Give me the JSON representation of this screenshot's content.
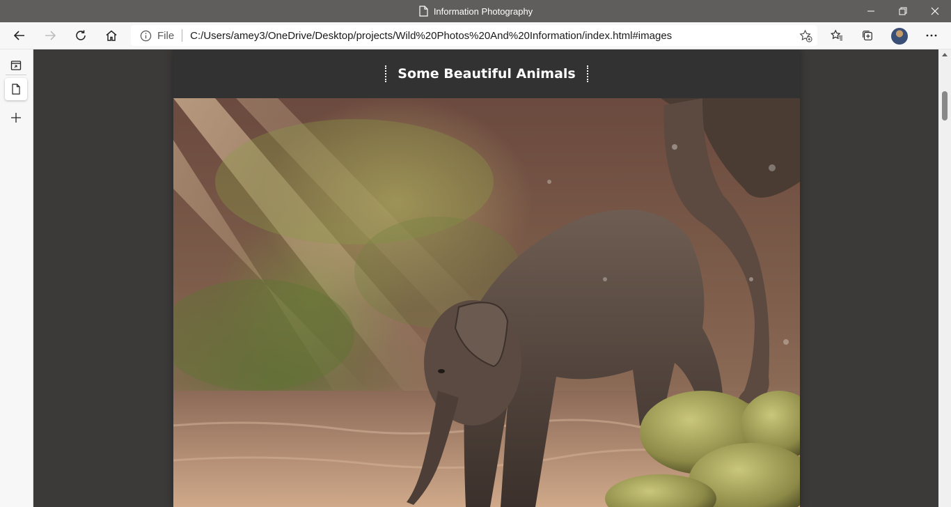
{
  "window": {
    "title": "Information Photography"
  },
  "toolbar": {
    "address_prefix": "File",
    "url": "C:/Users/amey3/OneDrive/Desktop/projects/Wild%20Photos%20And%20Information/index.html#images"
  },
  "page": {
    "section_heading": "Some Beautiful Animals"
  },
  "icons": {
    "page": "page-icon",
    "back": "back-arrow-icon",
    "forward": "forward-arrow-icon",
    "refresh": "refresh-icon",
    "home": "home-icon",
    "info": "info-icon",
    "add_favorite": "star-plus-icon",
    "favorites": "favorites-icon",
    "collections": "collections-icon",
    "more": "more-icon"
  }
}
